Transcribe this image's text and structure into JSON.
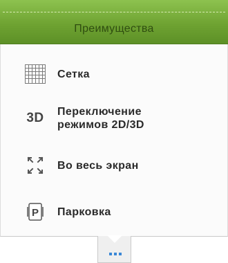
{
  "header": {
    "title": "Преимущества"
  },
  "items": [
    {
      "label": "Сетка",
      "icon": "grid-icon"
    },
    {
      "label_line1": "Переключение",
      "label_line2": "режимов 2D/3D",
      "icon_text": "3D",
      "icon": "3d-icon"
    },
    {
      "label": "Во весь экран",
      "icon": "fullscreen-icon"
    },
    {
      "label": "Парковка",
      "icon_text": "P",
      "icon": "parking-icon"
    }
  ],
  "tab": {
    "icon": "more-dots-icon"
  },
  "colors": {
    "header_green": "#6fa332",
    "header_text": "#2f4d10",
    "dots_blue": "#3a87d6"
  }
}
